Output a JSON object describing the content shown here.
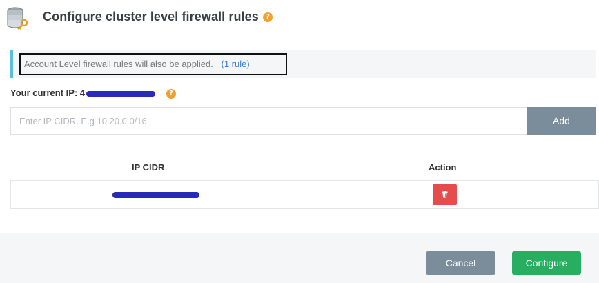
{
  "header": {
    "title": "Configure cluster level firewall rules",
    "help_glyph": "?"
  },
  "info": {
    "text": "Account Level firewall rules will also be applied.",
    "link": "(1 rule)"
  },
  "current_ip": {
    "label": "Your current IP:",
    "value_prefix": "4",
    "help_glyph": "?"
  },
  "cidr_input": {
    "placeholder": "Enter IP CIDR. E.g 10.20.0.0/16",
    "value": ""
  },
  "add_label": "Add",
  "table": {
    "columns": [
      "IP CIDR",
      "Action"
    ]
  },
  "footer": {
    "cancel_label": "Cancel",
    "configure_label": "Configure"
  },
  "colors": {
    "accent_info": "#5bc0de",
    "help": "#f0a030",
    "delete": "#e74c4c",
    "configure": "#27ae60",
    "secondary": "#7b8c9a",
    "redaction": "#2a2ab8"
  }
}
